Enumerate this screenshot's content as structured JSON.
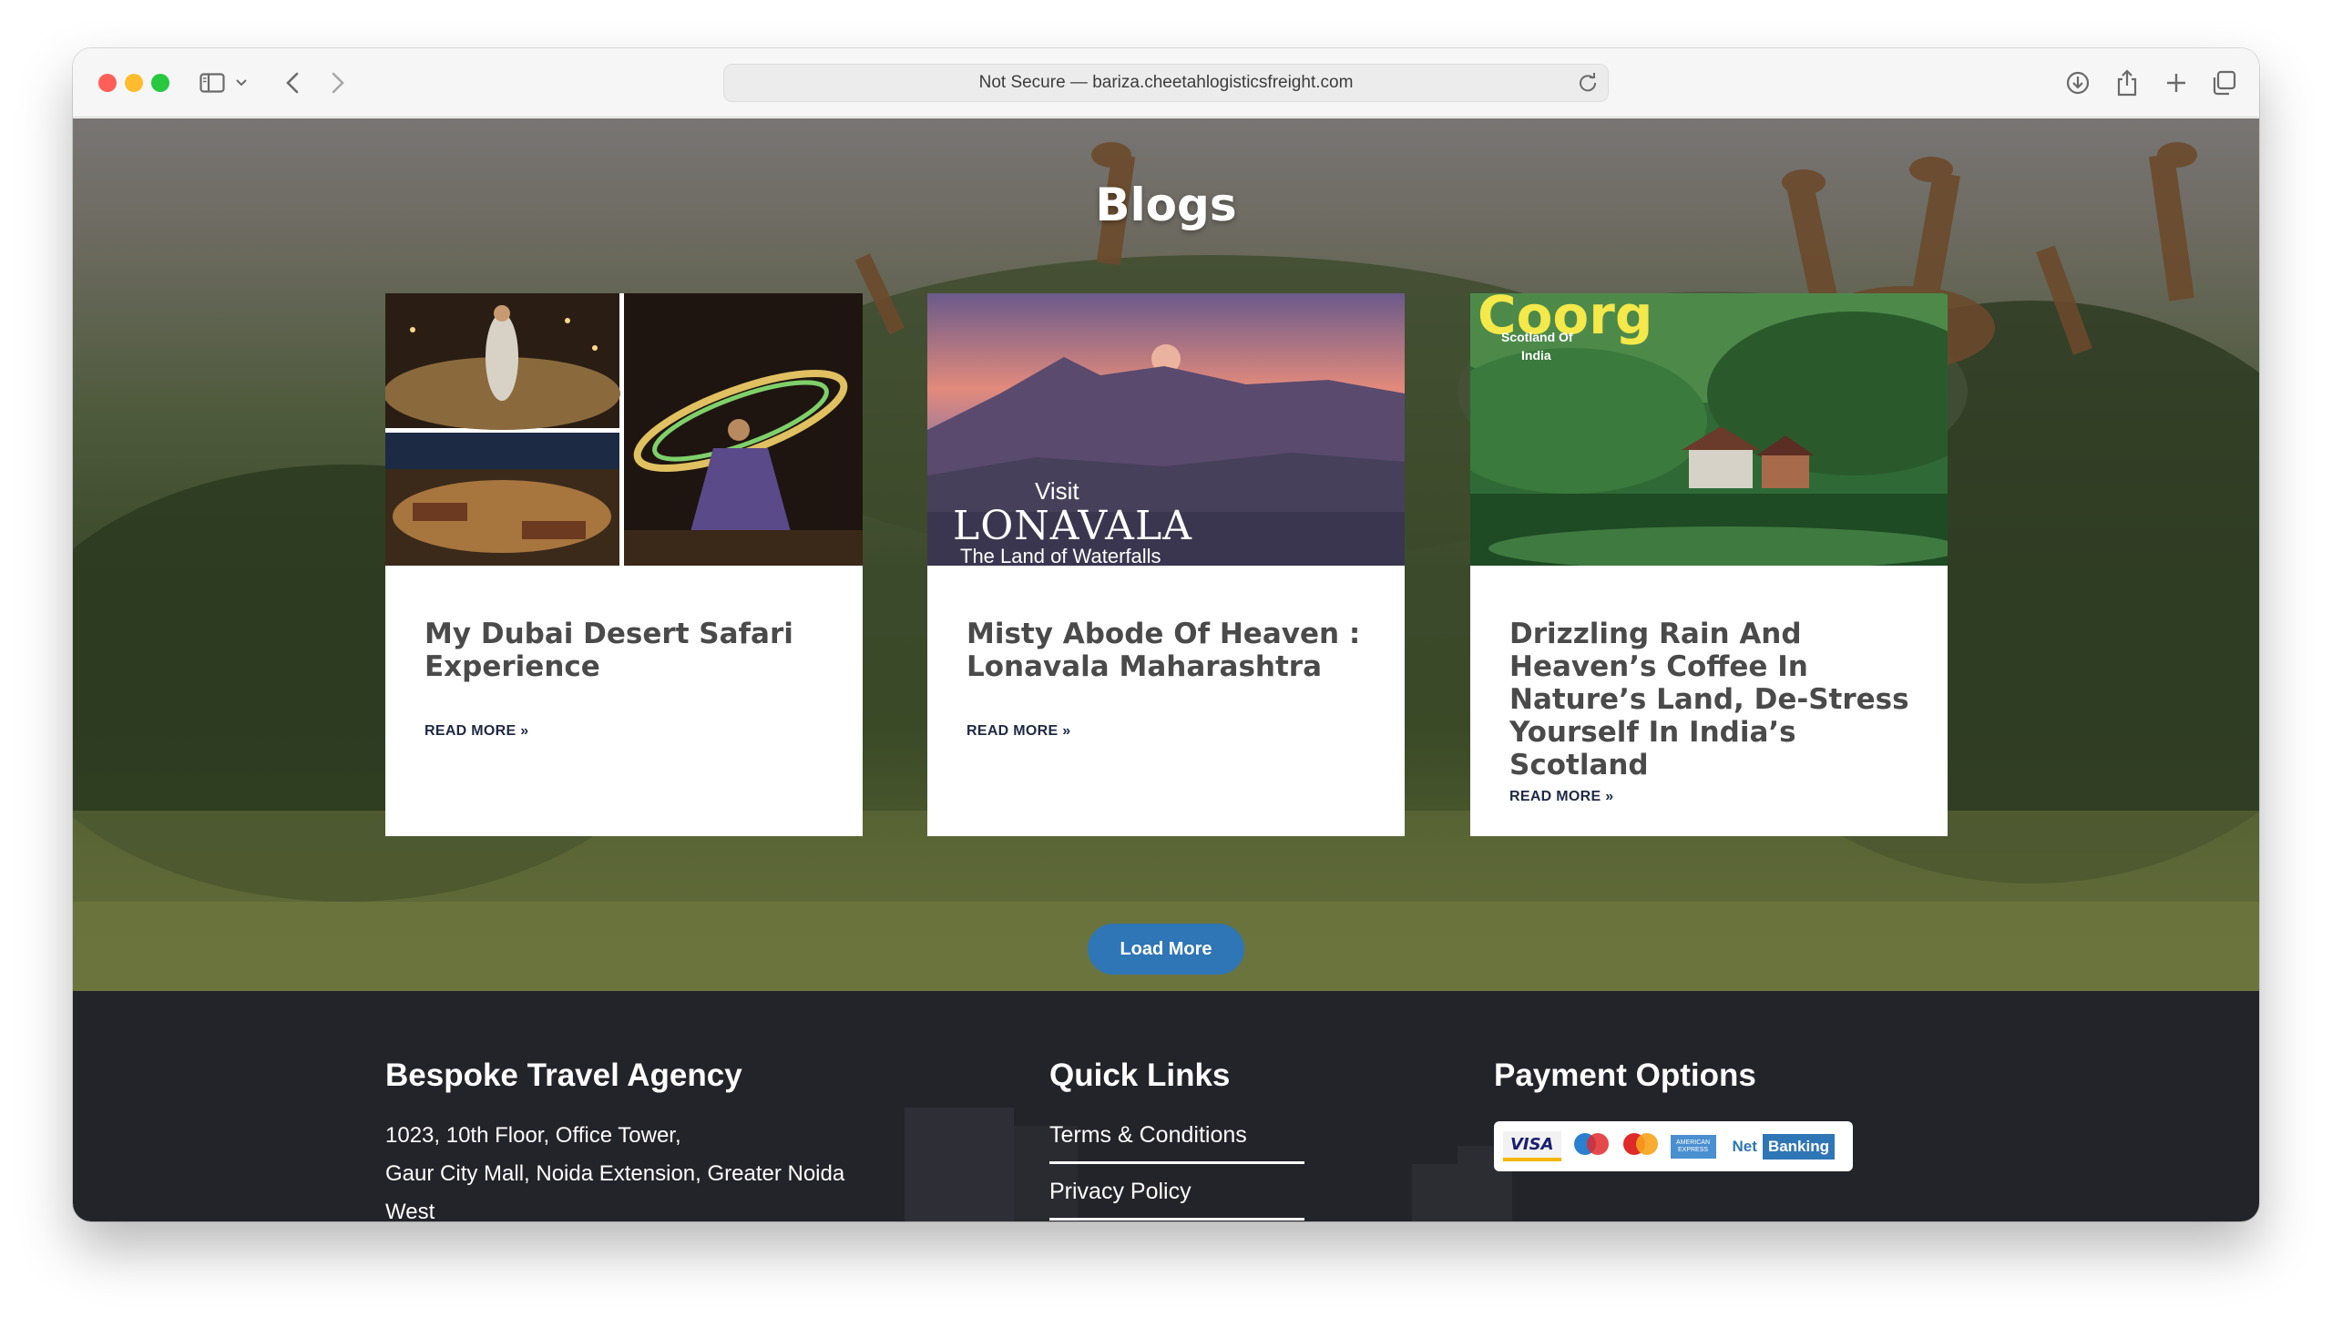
{
  "browser": {
    "address_text": "Not Secure — bariza.cheetahlogisticsfreight.com"
  },
  "hero": {
    "title": "Blogs"
  },
  "cards": [
    {
      "title": "My Dubai Desert Safari Experience",
      "link_label": "READ MORE »"
    },
    {
      "title": "Misty Abode Of Heaven : Lonavala Maharashtra",
      "link_label": "READ MORE »",
      "image_text": {
        "visit": "Visit",
        "place": "LONAVALA",
        "tagline": "The Land of Waterfalls"
      }
    },
    {
      "title": "Drizzling Rain And Heaven’s Coffee In Nature’s Land, De-Stress Yourself In India’s Scotland",
      "link_label": "READ MORE »",
      "image_text": {
        "place": "Coorg",
        "tagline_1": "Scotland Of",
        "tagline_2": "India"
      }
    }
  ],
  "load_more_label": "Load More",
  "footer": {
    "agency": {
      "heading": "Bespoke Travel Agency",
      "address_line_1": "1023, 10th Floor, Office Tower,",
      "address_line_2": "Gaur City Mall, Noida Extension, Greater Noida",
      "address_line_3": "West"
    },
    "quick_links": {
      "heading": "Quick Links",
      "items": [
        "Terms & Conditions",
        "Privacy Policy"
      ]
    },
    "payment": {
      "heading": "Payment Options",
      "visa": "VISA",
      "maestro": "Maestro",
      "mastercard": "MasterCard",
      "amex": "AMERICAN EXPRESS",
      "net_banking_1": "Net",
      "net_banking_2": "Banking"
    }
  },
  "colors": {
    "accent": "#2f76b6",
    "footer_bg": "#23232a",
    "card_title": "#4a4a4a",
    "link": "#1e2a44"
  }
}
